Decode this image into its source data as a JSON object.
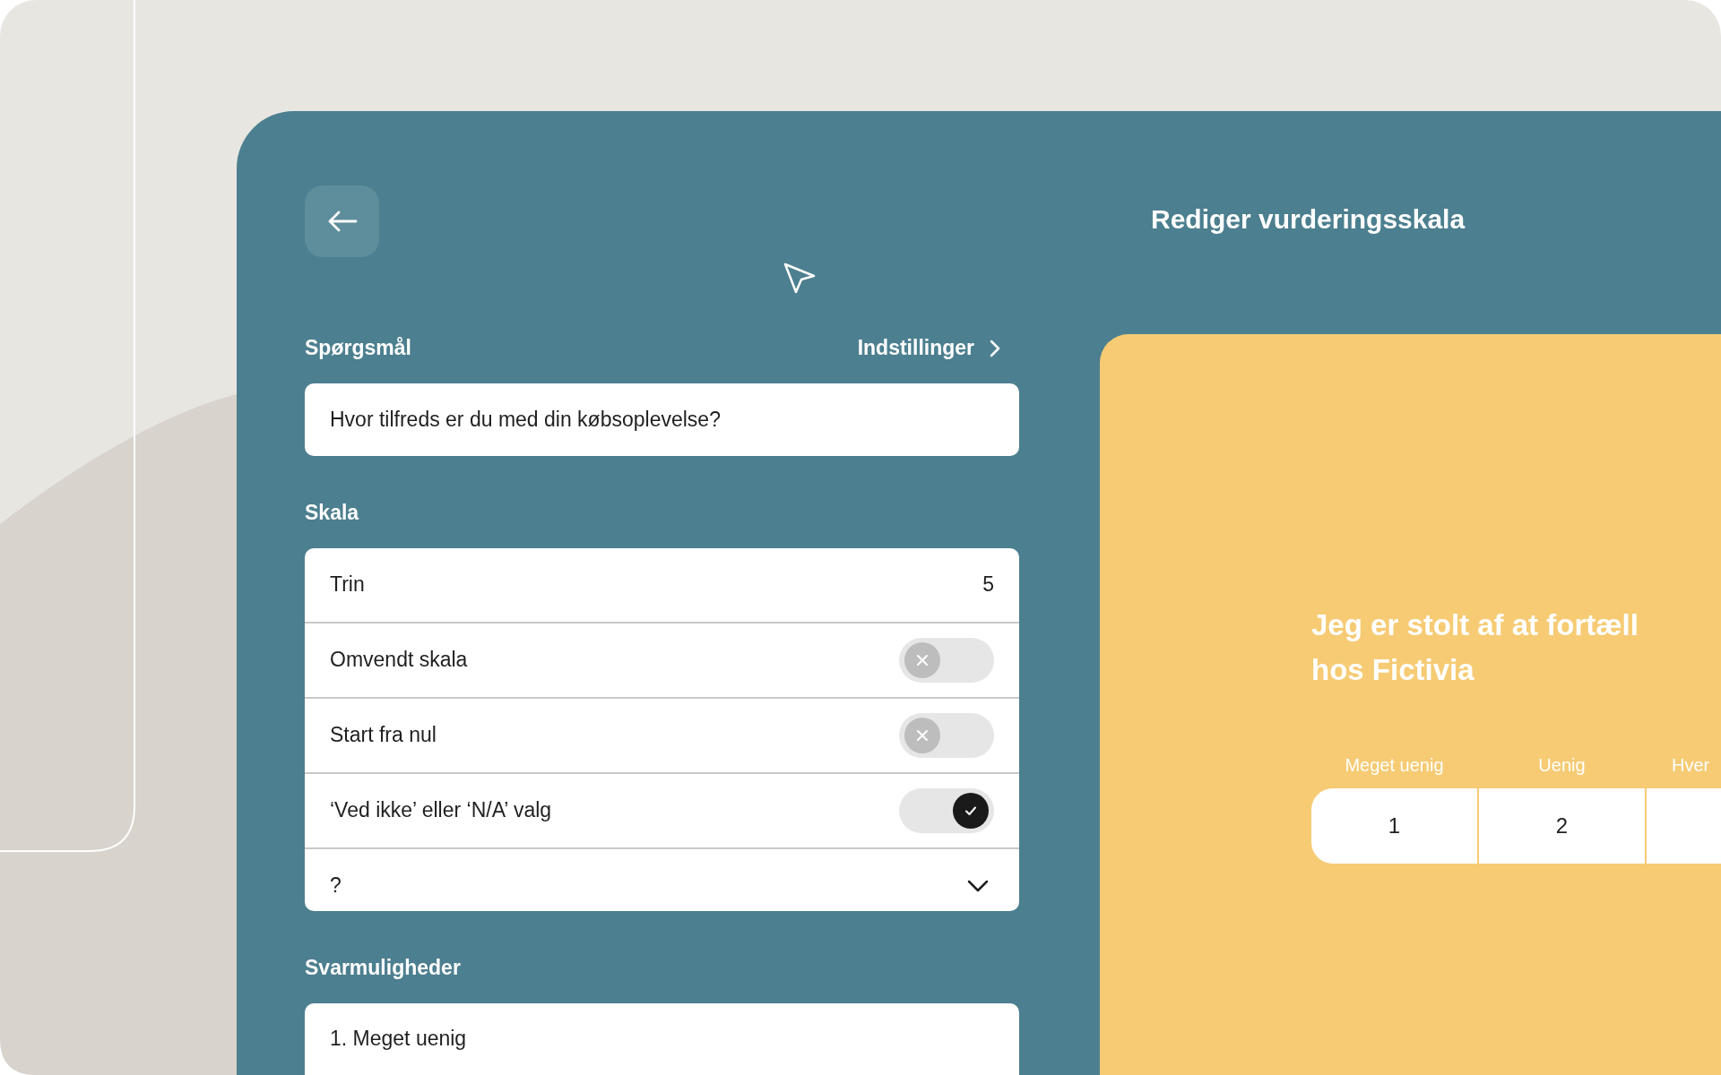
{
  "header": {
    "title": "Rediger vurderingsskala"
  },
  "question": {
    "label": "Spørgsmål",
    "settings_link": "Indstillinger",
    "value": "Hvor tilfreds er du med din købsoplevelse?"
  },
  "scale": {
    "label": "Skala",
    "rows": [
      {
        "kind": "value",
        "label": "Trin",
        "value": "5"
      },
      {
        "kind": "toggle",
        "label": "Omvendt skala",
        "on": false
      },
      {
        "kind": "toggle",
        "label": "Start fra nul",
        "on": false
      },
      {
        "kind": "toggle",
        "label": "‘Ved ikke’ eller ‘N/A’ valg",
        "on": true
      },
      {
        "kind": "dropdown",
        "label": "?"
      }
    ]
  },
  "answers": {
    "label": "Svarmuligheder",
    "items": [
      "1. Meget uenig"
    ]
  },
  "preview": {
    "heading_lines": [
      "Jeg er stolt af at fortæll",
      "hos Fictivia"
    ],
    "options": [
      {
        "label": "Meget uenig",
        "value": "1"
      },
      {
        "label": "Uenig",
        "value": "2"
      },
      {
        "label": "Hver"
      }
    ]
  }
}
